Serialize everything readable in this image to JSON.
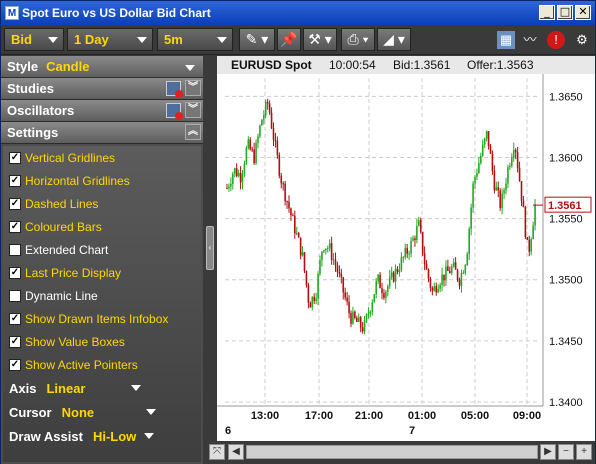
{
  "window": {
    "title": "Spot Euro vs US Dollar Bid Chart",
    "minimize": "_",
    "maximize": "□",
    "close": "✕"
  },
  "toolbar": {
    "price_type": "Bid",
    "period": "1 Day",
    "interval": "5m",
    "icons": [
      "pen-icon",
      "pin-icon",
      "tools-icon",
      "print-icon",
      "chart-type-icon",
      "layout-icon",
      "indicator-icon",
      "alert-icon",
      "settings-icon"
    ]
  },
  "side": {
    "style_label": "Style",
    "style_value": "Candle",
    "studies_label": "Studies",
    "oscillators_label": "Oscillators",
    "settings_label": "Settings",
    "checkboxes": [
      {
        "label": "Vertical Gridlines",
        "checked": true
      },
      {
        "label": "Horizontal Gridlines",
        "checked": true
      },
      {
        "label": "Dashed Lines",
        "checked": true
      },
      {
        "label": "Coloured Bars",
        "checked": true
      },
      {
        "label": "Extended Chart",
        "checked": false
      },
      {
        "label": "Last Price Display",
        "checked": true
      },
      {
        "label": "Dynamic Line",
        "checked": false
      },
      {
        "label": "Show Drawn Items Infobox",
        "checked": true
      },
      {
        "label": "Show Value Boxes",
        "checked": true
      },
      {
        "label": "Show Active Pointers",
        "checked": true
      }
    ],
    "axis_label": "Axis",
    "axis_value": "Linear",
    "cursor_label": "Cursor",
    "cursor_value": "None",
    "draw_assist_label": "Draw Assist",
    "draw_assist_value": "Hi-Low"
  },
  "chart_header": {
    "symbol": "EURUSD Spot",
    "time": "10:00:54",
    "bid": "Bid:1.3561",
    "offer": "Offer:1.3563"
  },
  "chart_data": {
    "type": "candlestick",
    "last_price": "1.3561",
    "yticks": [
      "1.3650",
      "1.3600",
      "1.3550",
      "1.3500",
      "1.3450",
      "1.3400"
    ],
    "ytick_values": [
      1.365,
      1.36,
      1.355,
      1.35,
      1.345,
      1.34
    ],
    "ylim": [
      1.34,
      1.3665
    ],
    "xticks": [
      "13:00",
      "17:00",
      "21:00",
      "01:00",
      "05:00",
      "09:00"
    ],
    "day_labels": [
      "6",
      "7"
    ],
    "up_color": "#22aa22",
    "down_color": "#b01010",
    "close_path": [
      1.3575,
      1.359,
      1.3585,
      1.361,
      1.36,
      1.363,
      1.3645,
      1.361,
      1.358,
      1.356,
      1.354,
      1.352,
      1.348,
      1.349,
      1.353,
      1.3525,
      1.351,
      1.349,
      1.347,
      1.3465,
      1.346,
      1.348,
      1.35,
      1.349,
      1.35,
      1.351,
      1.352,
      1.353,
      1.3545,
      1.351,
      1.349,
      1.35,
      1.3505,
      1.351,
      1.35,
      1.352,
      1.358,
      1.36,
      1.362,
      1.358,
      1.356,
      1.359,
      1.3615,
      1.357,
      1.352,
      1.3561
    ]
  }
}
